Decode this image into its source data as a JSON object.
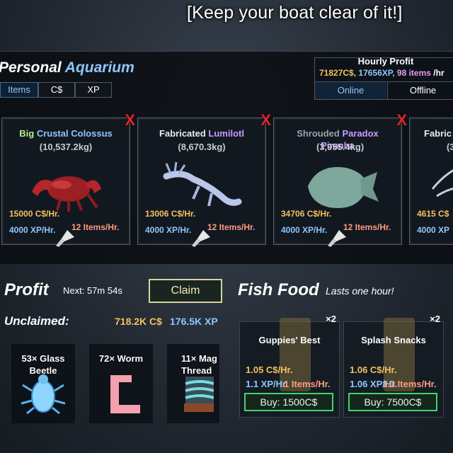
{
  "banner": "[Keep your boat clear of it!]",
  "aquarium": {
    "title_main": "Personal",
    "title_accent": "Aquarium",
    "tabs": [
      "Items",
      "C$",
      "XP"
    ],
    "active_tab": "Items"
  },
  "hourly": {
    "label": "Hourly Profit",
    "cash": "71827C$,",
    "xp": "17656XP,",
    "items": "98 items",
    "per": "/hr",
    "online": "Online",
    "offline": "Offline"
  },
  "fish": [
    {
      "prefix": "Big",
      "mid": "Crustal",
      "name2": "Colossus",
      "weight": "(10,537.2kg)",
      "cash": "15000 C$/Hr.",
      "xp": "4000 XP/Hr.",
      "items": "12 Items/Hr.",
      "remove": "X"
    },
    {
      "prefix": "Fabricated",
      "mid": "",
      "name2": "Lumilotl",
      "weight": "(8,670.3kg)",
      "cash": "13006 C$/Hr.",
      "xp": "4000 XP/Hr.",
      "items": "12 Items/Hr.",
      "remove": "X"
    },
    {
      "prefix": "Shrouded",
      "mid": "Paradox",
      "name2": "Piranha",
      "weight": "(3,955.4kg)",
      "cash": "34706 C$/Hr.",
      "xp": "4000 XP/Hr.",
      "items": "12 Items/Hr.",
      "remove": "X"
    },
    {
      "prefix": "Fabric",
      "mid": "",
      "name2": "",
      "weight": "(3",
      "cash": "4615 C$",
      "xp": "4000 XP",
      "items": "",
      "remove": ""
    }
  ],
  "profit": {
    "title": "Profit",
    "next": "Next: 57m 54s",
    "claim": "Claim",
    "unclaimed_label": "Unclaimed:",
    "unclaimed_cash": "718.2K C$",
    "unclaimed_xp": "176.5K XP",
    "items": [
      {
        "label": "53× Glass Beetle"
      },
      {
        "label": "72× Worm"
      },
      {
        "label": "11× Mag Thread"
      }
    ]
  },
  "food": {
    "title": "Fish Food",
    "subtitle": "Lasts one hour!",
    "cards": [
      {
        "multiplier": "×2",
        "name": "Guppies' Best",
        "cash": "1.05 C$/Hr.",
        "xp": "1.1 XP/Hr.",
        "items": "1 Items/Hr.",
        "buy": "Buy: 1500C$"
      },
      {
        "multiplier": "×2",
        "name": "Splash Snacks",
        "cash": "1.06 C$/Hr.",
        "xp": "1.06 XP/Hr.",
        "items": "1.3 Items/Hr.",
        "buy": "Buy: 7500C$"
      }
    ]
  },
  "colors": {
    "accent": "#8ec7ff",
    "cash": "#f2c15e",
    "xp": "#8ec7ff",
    "remove": "#e0242a",
    "buy_border": "#3cd66d"
  }
}
